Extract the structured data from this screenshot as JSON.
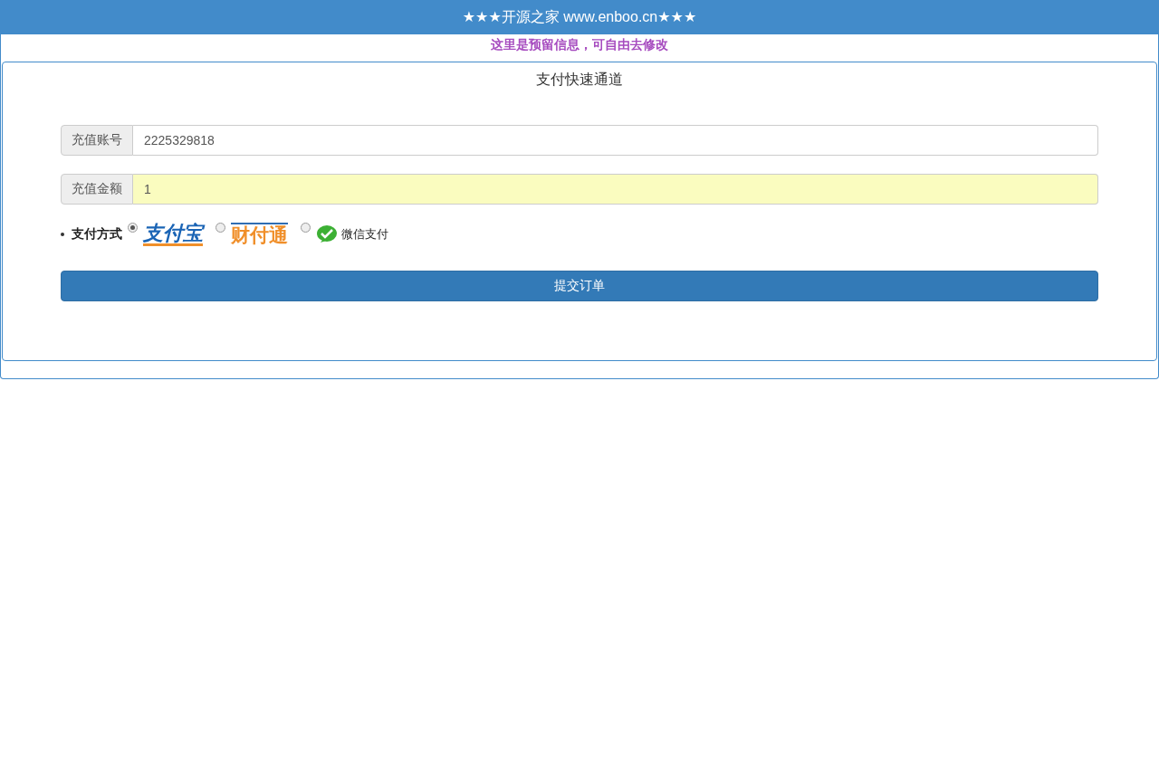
{
  "header": {
    "title": "★★★开源之家 www.enboo.cn★★★"
  },
  "notice": "这里是预留信息，可自由去修改",
  "panel": {
    "title": "支付快速通道",
    "fields": [
      {
        "label": "充值账号",
        "value": "2225329818",
        "highlighted": false
      },
      {
        "label": "充值金额",
        "value": "1",
        "highlighted": true
      }
    ],
    "payment": {
      "label": "支付方式",
      "options": [
        {
          "kind": "alipay",
          "text": "支付宝",
          "selected": true
        },
        {
          "kind": "tenpay",
          "text": "财付通",
          "selected": false
        },
        {
          "kind": "wechat",
          "text": "微信支付",
          "selected": false
        }
      ]
    },
    "submit": "提交订单"
  }
}
